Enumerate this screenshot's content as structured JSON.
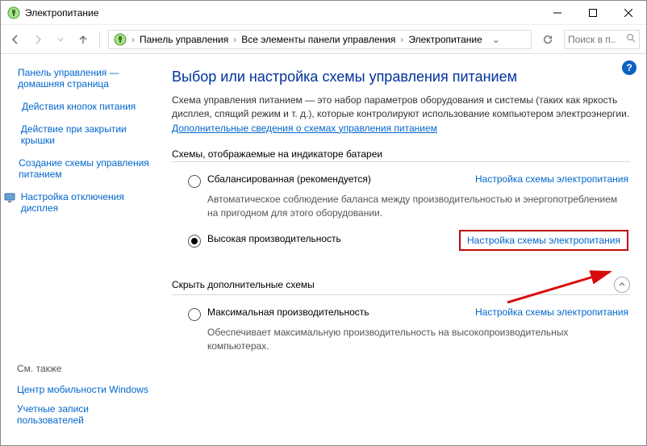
{
  "window": {
    "title": "Электропитание"
  },
  "breadcrumb": {
    "root": "Панель управления",
    "mid": "Все элементы панели управления",
    "leaf": "Электропитание"
  },
  "search": {
    "placeholder": "Поиск в п..."
  },
  "sidebar": {
    "items": [
      {
        "label": "Панель управления — домашняя страница",
        "icon": null
      },
      {
        "label": "Действия кнопок питания",
        "icon": null
      },
      {
        "label": "Действие при закрытии крышки",
        "icon": null
      },
      {
        "label": "Создание схемы управления питанием",
        "icon": null
      },
      {
        "label": "Настройка отключения дисплея",
        "icon": "monitor"
      }
    ],
    "see_also_hdr": "См. также",
    "see_also": [
      "Центр мобильности Windows",
      "Учетные записи пользователей"
    ]
  },
  "content": {
    "title": "Выбор или настройка схемы управления питанием",
    "intro_a": "Схема управления питанием — это набор параметров оборудования и системы (таких как яркость дисплея, спящий режим и т. д.), которые контролируют использование компьютером электроэнергии. ",
    "intro_link": "Дополнительные сведения о схемах управления питанием",
    "group1_hdr": "Схемы, отображаемые на индикаторе батареи",
    "plan1_name": "Сбалансированная (рекомендуется)",
    "plan1_desc": "Автоматическое соблюдение баланса между производительностью и энергопотреблением на пригодном для этого оборудовании.",
    "plan2_name": "Высокая производительность",
    "settings_link": "Настройка схемы электропитания",
    "group2_hdr": "Скрыть дополнительные схемы",
    "plan3_name": "Максимальная производительность",
    "plan3_desc": "Обеспечивает максимальную производительность на высокопроизводительных компьютерах."
  }
}
